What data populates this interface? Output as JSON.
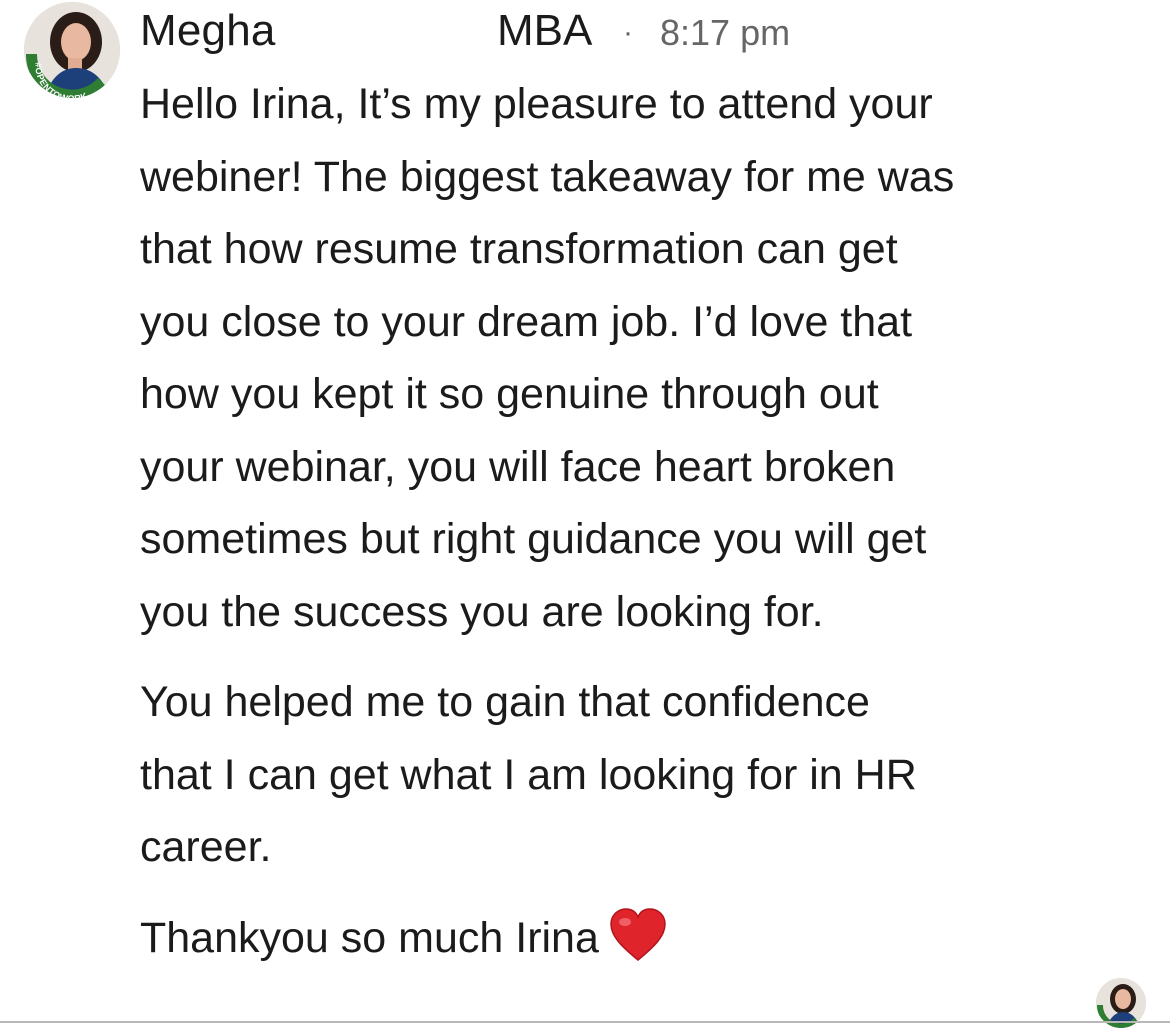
{
  "sender": {
    "name": "Megha",
    "degree": "MBA",
    "separator": "·",
    "time": "8:17 pm",
    "avatar_icon": "profile-photo-icon",
    "avatar_badge_text": "#OPENTOWORK",
    "badge_color": "#2e7d32"
  },
  "message": {
    "paragraph1": "Hello Irina, It’s my pleasure to attend your\nwebiner! The biggest takeaway for me was\nthat how resume transformation can get\nyou close to your dream job. I’d love that\nhow you kept it so genuine through out\nyour webinar, you will face heart broken\nsometimes but right guidance you will get\nyou the success you are looking for.",
    "paragraph2": "You helped me to gain that confidence\nthat I can get what I am looking for in HR\ncareer.",
    "paragraph3": "Thankyou so much Irina",
    "emoji": "heart-icon",
    "emoji_color": "#e0242b"
  },
  "read_receipt": {
    "icon": "seen-by-avatar-icon"
  }
}
